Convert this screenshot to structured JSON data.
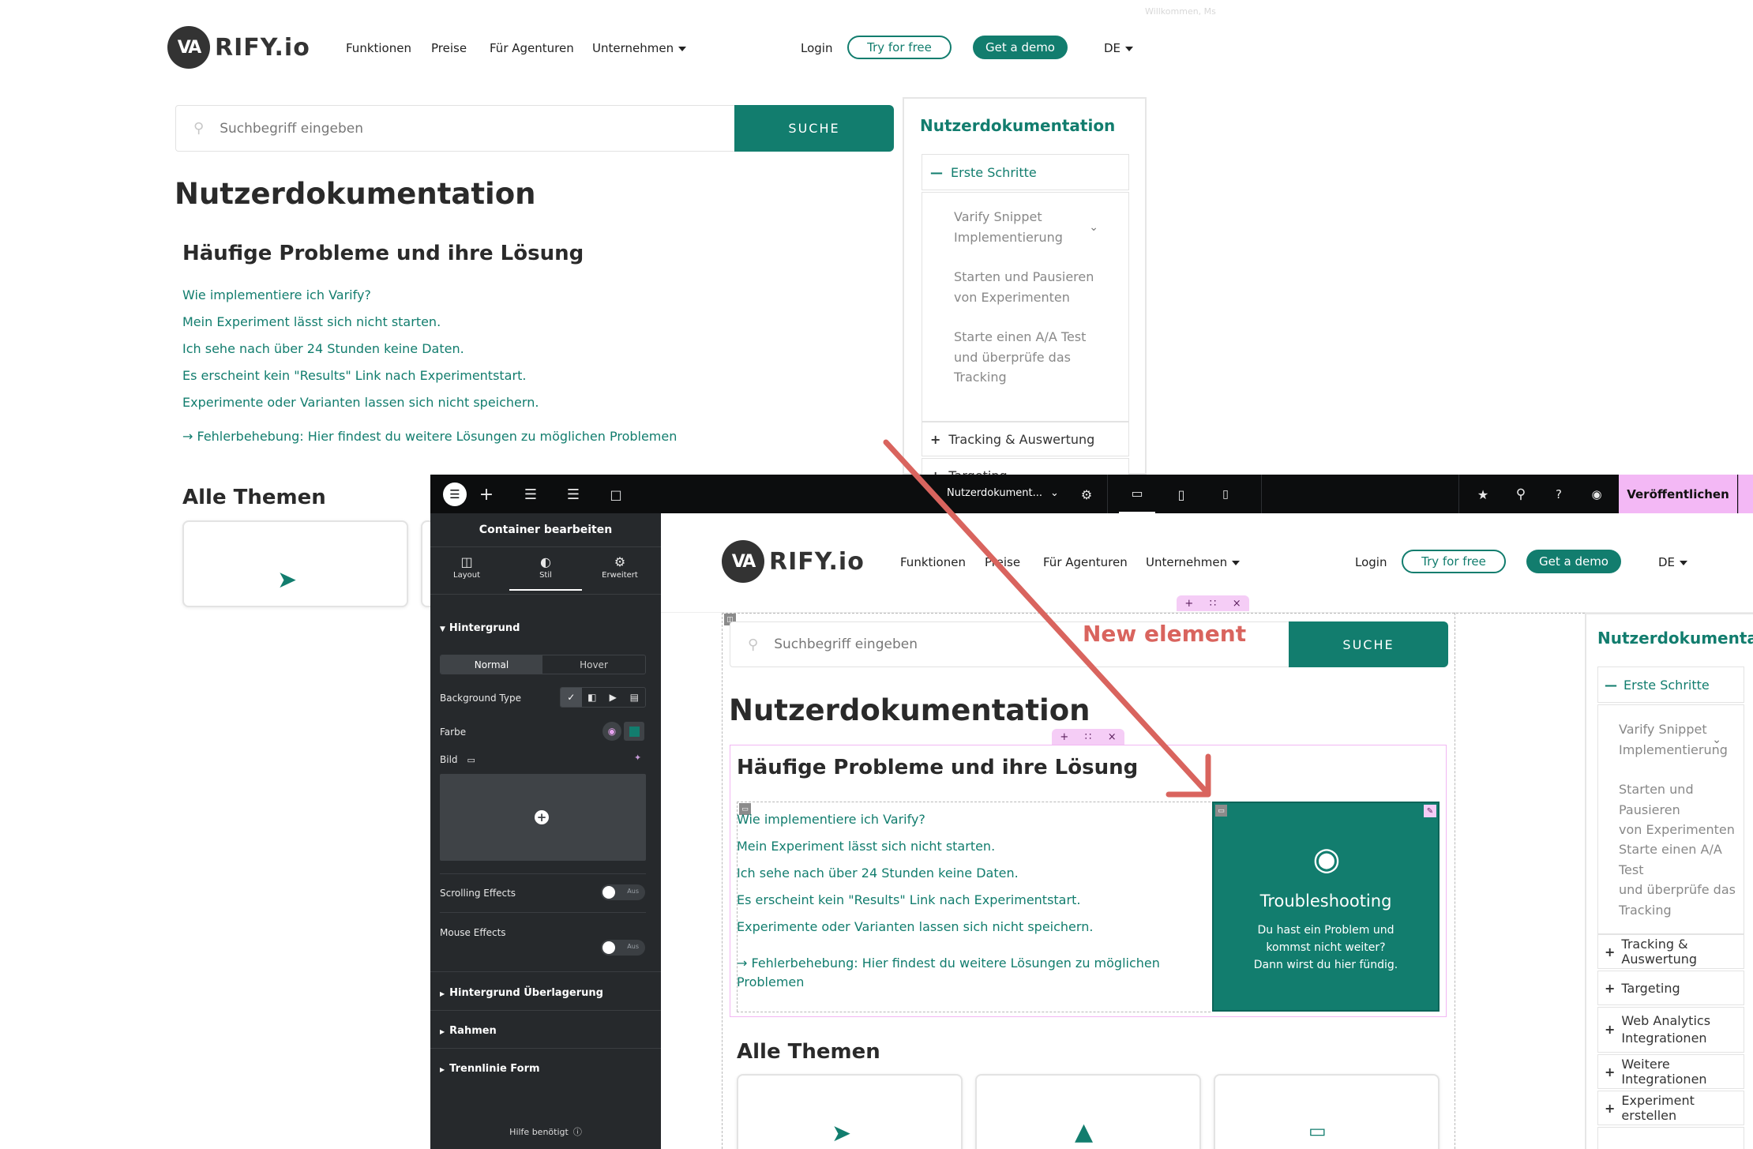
{
  "site": {
    "welcome": "Willkommen, Ms",
    "logo_mark": "VA",
    "logo_text": "RIFY.io",
    "nav": [
      "Funktionen",
      "Preise",
      "Für Agenturen",
      "Unternehmen"
    ],
    "login": "Login",
    "try_free": "Try for free",
    "get_demo": "Get a demo",
    "lang": "DE",
    "search_placeholder": "Suchbegriff eingeben",
    "search_button": "SUCHE",
    "page_title": "Nutzerdokumentation",
    "section_title": "Häufige Probleme und ihre Lösung",
    "faq": [
      "Wie implementiere ich Varify?",
      "Mein Experiment lässt sich nicht starten.",
      "Ich sehe nach über 24 Stunden keine Daten.",
      "Es erscheint kein \"Results\" Link nach Experimentstart.",
      "Experimente oder Varianten lassen sich nicht speichern."
    ],
    "troubleshoot_link": "→ Fehlerbehebung: Hier findest du weitere Lösungen zu möglichen Problemen",
    "troubleshoot_link_l1": "→ Fehlerbehebung: Hier findest du weitere Lösungen zu möglichen",
    "troubleshoot_link_l2": "Problemen",
    "all_topics": "Alle Themen",
    "sidebar_title": "Nutzerdokumentation",
    "sidebar_first": "Erste Schritte",
    "sidebar_sub": [
      "Varify Snippet Implementierung",
      "Starten und Pausieren von Experimenten",
      "Starte einen A/A Test und überprüfe das Tracking"
    ],
    "sidebar_sub_lines": [
      [
        "Varify Snippet",
        "Implementierung"
      ],
      [
        "Starten und Pausieren",
        "von Experimenten"
      ],
      [
        "Starte einen A/A Test",
        "und überprüfe das",
        "Tracking"
      ]
    ],
    "sidebar_sections": [
      "Tracking & Auswertung",
      "Targeting",
      "Web Analytics Integrationen",
      "Weitere Integrationen",
      "Experiment erstellen"
    ],
    "card_title": "Troubleshooting",
    "card_text_lines": [
      "Du hast ein Problem und",
      "kommst nicht weiter?",
      "Dann wirst du hier fündig."
    ],
    "new_element_label": "New element"
  },
  "editor": {
    "doc_title": "Nutzerdokument...",
    "publish": "Veröffentlichen",
    "panel_title": "Container bearbeiten",
    "tabs": [
      "Layout",
      "Stil",
      "Erweitert"
    ],
    "section_bg": "Hintergrund",
    "state_normal": "Normal",
    "state_hover": "Hover",
    "bg_type": "Background Type",
    "color": "Farbe",
    "image": "Bild",
    "scrolling": "Scrolling Effects",
    "mouse": "Mouse Effects",
    "toggle_off": "Aus",
    "overlay": "Hintergrund Überlagerung",
    "border": "Rahmen",
    "divider": "Trennlinie Form",
    "help": "Hilfe benötigt",
    "accent": "#127d6e",
    "publish_color": "#f3b8f5"
  }
}
